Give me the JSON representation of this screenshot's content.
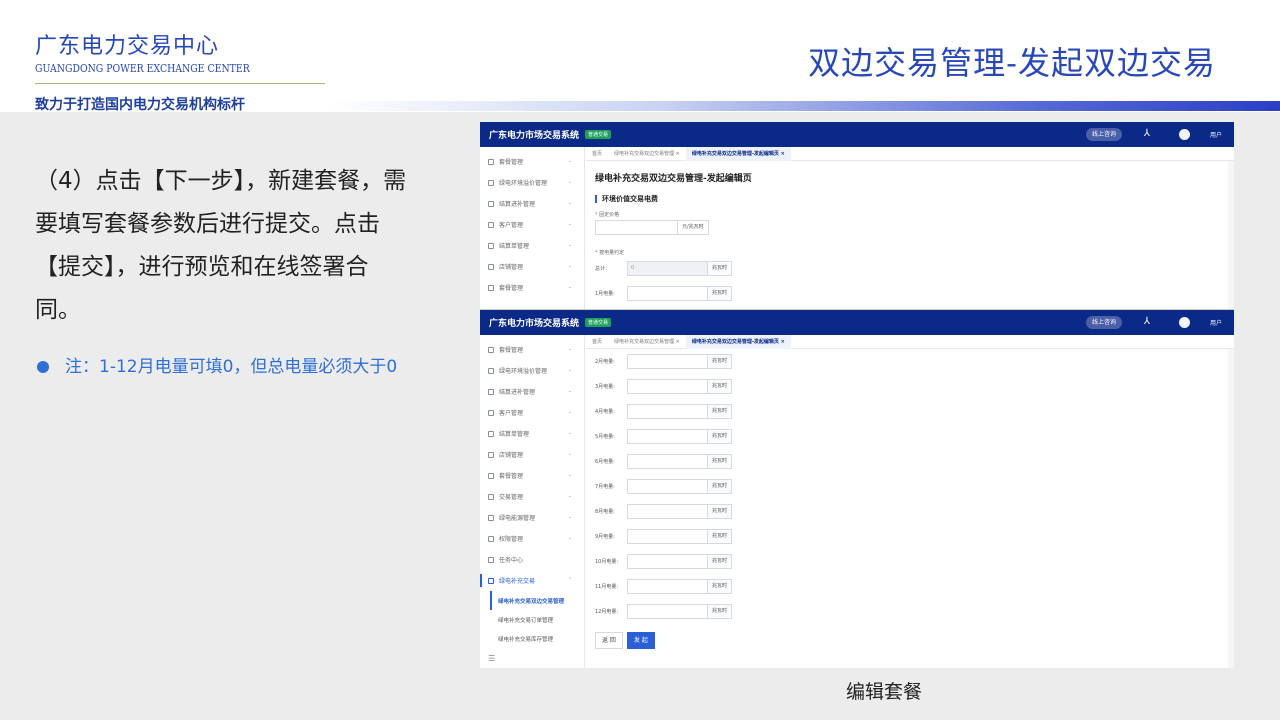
{
  "header": {
    "org_cn": "广东电力交易中心",
    "org_en": "GUANGDONG POWER EXCHANGE CENTER",
    "slogan": "致力于打造国内电力交易机构标杆",
    "slide_title": "双边交易管理-发起双边交易"
  },
  "instructions": {
    "step_text": "（4）点击【下一步】，新建套餐，需要填写套餐参数后进行提交。点击【提交】，进行预览和在线签署合同。",
    "note": "注：1-12月电量可填0，但总电量必须大于0"
  },
  "app": {
    "system_name": "广东电力市场交易系统",
    "env_tag": "普通交易",
    "consult": "线上咨询",
    "user": "用户",
    "tabs": [
      "首页",
      "绿电补充交易双边交易管理",
      "绿电补充交易双边交易管理-发起编辑页"
    ],
    "sidebar_short": [
      "套餐管理",
      "绿电环境溢价管理",
      "结算进补管理",
      "客户管理",
      "结算单管理",
      "店铺管理",
      "套餐管理"
    ],
    "sidebar_full": [
      "套餐管理",
      "绿电环境溢价管理",
      "结算进补管理",
      "客户管理",
      "结算单管理",
      "店铺管理",
      "套餐管理",
      "交易管理",
      "绿电能源管理",
      "权限管理",
      "任务中心",
      "绿电补充交易"
    ],
    "sidebar_sub": [
      "绿电补充交易双边交易管理",
      "绿电补充交易订单管理",
      "绿电补充交易库存管理"
    ],
    "collapse_icon": "☰",
    "page_heading": "绿电补充交易双边交易管理-发起编辑页",
    "section_heading": "环境价值交易电费",
    "price_label": "固定价格",
    "price_unit": "元/兆瓦时",
    "energy_label": "按电量约定",
    "total_label": "总计：",
    "total_value": "0",
    "energy_unit": "兆瓦时",
    "month1_label": "1月电量:",
    "months_visible": [
      "2月电量:",
      "3月电量:",
      "4月电量:",
      "5月电量:",
      "6月电量:",
      "7月电量:",
      "8月电量:",
      "9月电量:",
      "10月电量:",
      "11月电量:",
      "12月电量:"
    ],
    "back_button": "返 回",
    "submit_button": "发 起"
  },
  "caption": "编辑套餐",
  "colors": {
    "brand_blue": "#2848b8",
    "topbar": "#0b2a87",
    "note_blue": "#2f6fd6",
    "primary": "#2a5fd6"
  }
}
